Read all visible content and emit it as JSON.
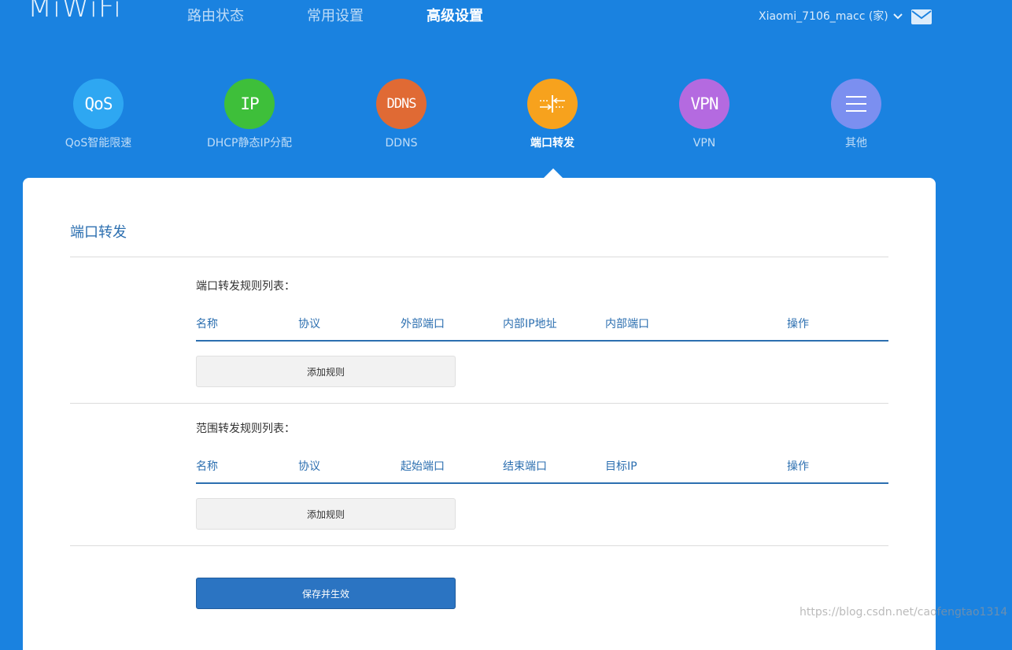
{
  "header": {
    "logo": "MiWiFi",
    "nav": [
      "路由状态",
      "常用设置",
      "高级设置"
    ],
    "active_nav": "高级设置",
    "user": "Xiaomi_7106_macc (家)"
  },
  "features": [
    {
      "icon_text": "QoS",
      "label": "QoS智能限速",
      "color": "#2ea7f2"
    },
    {
      "icon_text": "IP",
      "label": "DHCP静态IP分配",
      "color": "#3ebf3a"
    },
    {
      "icon_text": "DDNS",
      "label": "DDNS",
      "color": "#e06a34"
    },
    {
      "icon_text": "",
      "label": "端口转发",
      "color": "#f7a21d",
      "icon": "port-forward-icon"
    },
    {
      "icon_text": "VPN",
      "label": "VPN",
      "color": "#b46ae0"
    },
    {
      "icon_text": "",
      "label": "其他",
      "color": "#7b8ff0",
      "icon": "menu-icon"
    }
  ],
  "panel": {
    "title": "端口转发",
    "port_section": {
      "title": "端口转发规则列表：",
      "columns": [
        "名称",
        "协议",
        "外部端口",
        "内部IP地址",
        "内部端口",
        "操作"
      ],
      "add_button": "添加规则"
    },
    "range_section": {
      "title": "范围转发规则列表：",
      "columns": [
        "名称",
        "协议",
        "起始端口",
        "结束端口",
        "目标IP",
        "操作"
      ],
      "add_button": "添加规则"
    },
    "save_button": "保存并生效"
  },
  "watermark": "https://blog.csdn.net/caofengtao1314"
}
